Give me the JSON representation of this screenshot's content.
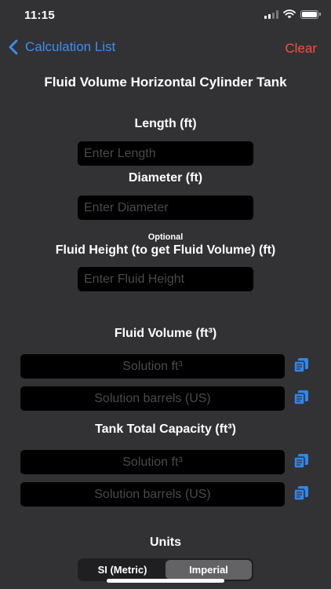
{
  "status_bar": {
    "time": "11:15"
  },
  "nav": {
    "back_label": "Calculation List",
    "clear_label": "Clear"
  },
  "page": {
    "title": "Fluid Volume Horizontal Cylinder Tank"
  },
  "inputs": {
    "length": {
      "label": "Length (ft)",
      "value": "",
      "placeholder": "Enter Length"
    },
    "diameter": {
      "label": "Diameter (ft)",
      "value": "",
      "placeholder": "Enter Diameter"
    },
    "fluid_height": {
      "optional_label": "Optional",
      "label": "Fluid Height (to get Fluid Volume) (ft)",
      "value": "",
      "placeholder": "Enter Fluid Height"
    }
  },
  "fluid_volume": {
    "heading": "Fluid Volume (ft³)",
    "solution_ft3_placeholder": "Solution ft³",
    "solution_barrels_placeholder": "Solution barrels (US)"
  },
  "tank_capacity": {
    "heading": "Tank Total Capacity (ft³)",
    "solution_ft3_placeholder": "Solution ft³",
    "solution_barrels_placeholder": "Solution barrels (US)"
  },
  "units": {
    "heading": "Units",
    "options": [
      "SI (Metric)",
      "Imperial"
    ],
    "selected": "Imperial"
  },
  "colors": {
    "background": "#323234",
    "accent_blue": "#3c8ff0",
    "destructive_red": "#ff4c3e",
    "field_background": "#000000",
    "placeholder_gray": "#4a4a4c"
  },
  "icons": {
    "back": "chevron-left-icon",
    "copy": "copy-icon",
    "wifi": "wifi-icon",
    "signal": "signal-icon",
    "battery": "battery-icon"
  }
}
